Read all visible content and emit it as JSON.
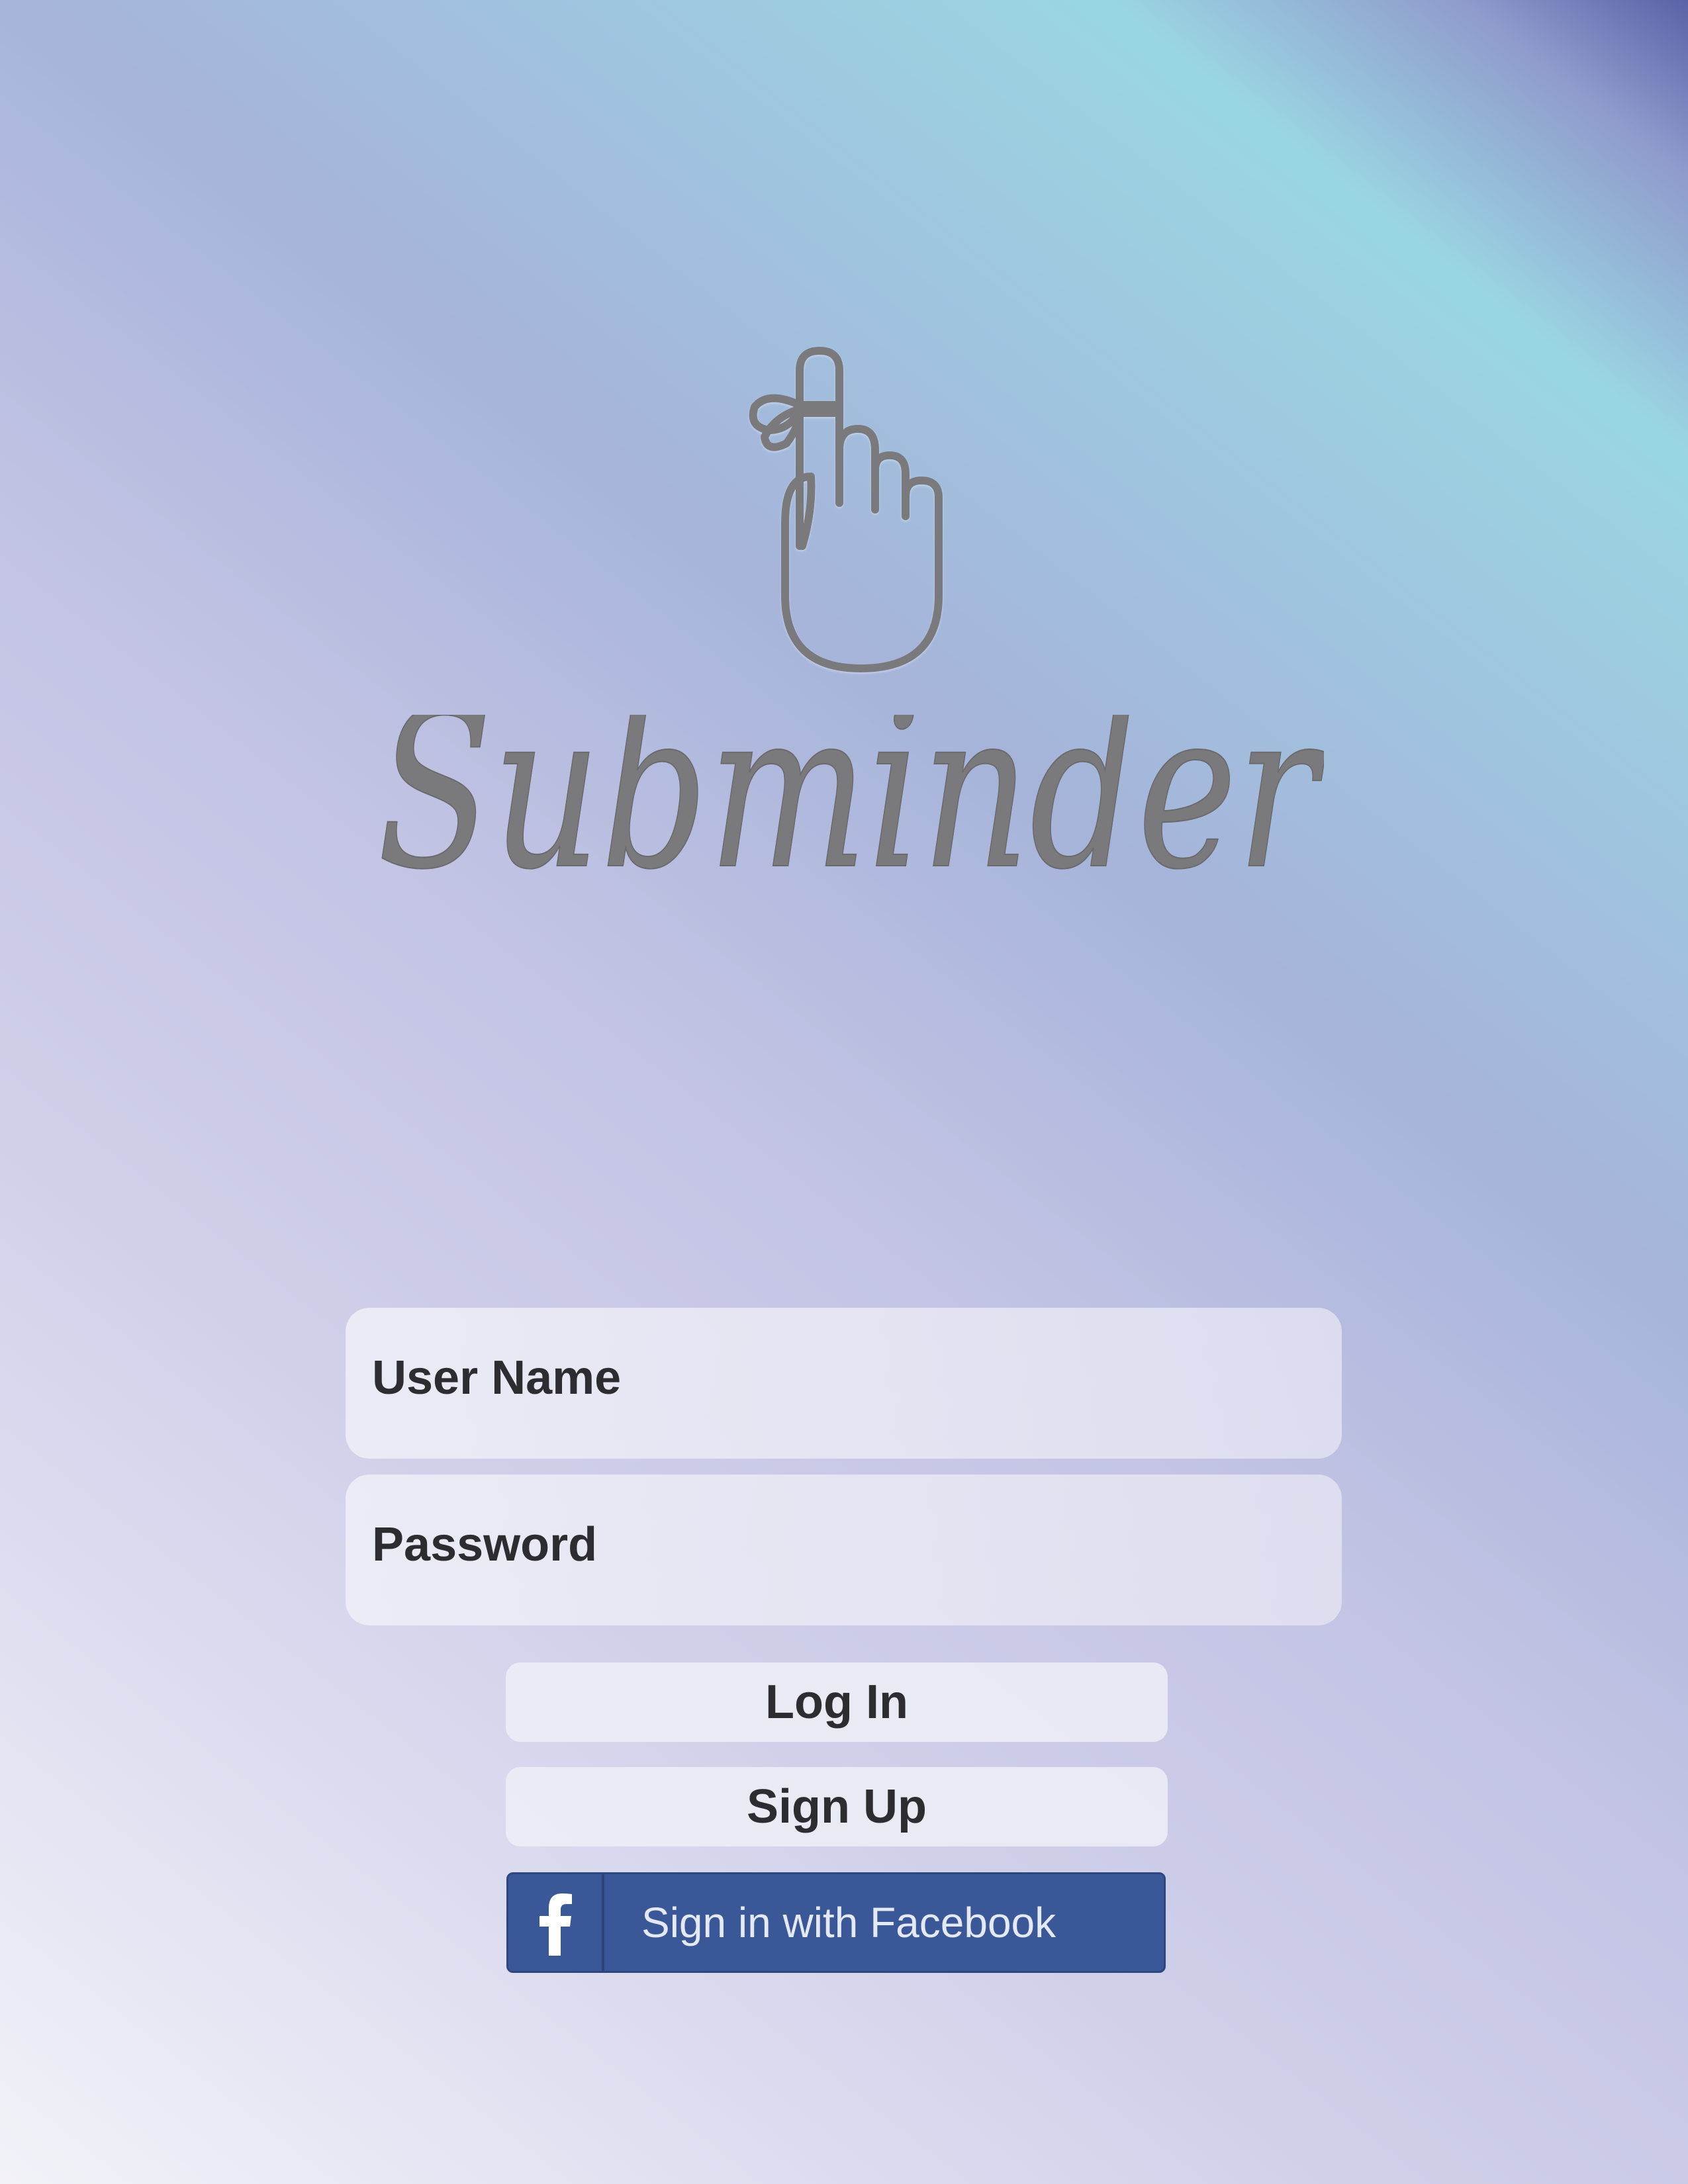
{
  "app": {
    "name": "Subminder"
  },
  "branding": {
    "logo_icon": "finger-with-string-bow-icon",
    "logo_text": "Subminder",
    "logo_color": "#7a7a7c"
  },
  "login_form": {
    "username_placeholder": "User Name",
    "username_value": "",
    "password_placeholder": "Password",
    "password_value": "",
    "login_label": "Log In",
    "signup_label": "Sign Up",
    "facebook_label": "Sign in with Facebook",
    "facebook_icon": "facebook-f-icon"
  },
  "colors": {
    "facebook_blue": "#3a5798",
    "text_dark": "#2c2c31",
    "background_accent_teal": "#9ad6e2",
    "background_accent_lavender": "#d0d0ea"
  }
}
